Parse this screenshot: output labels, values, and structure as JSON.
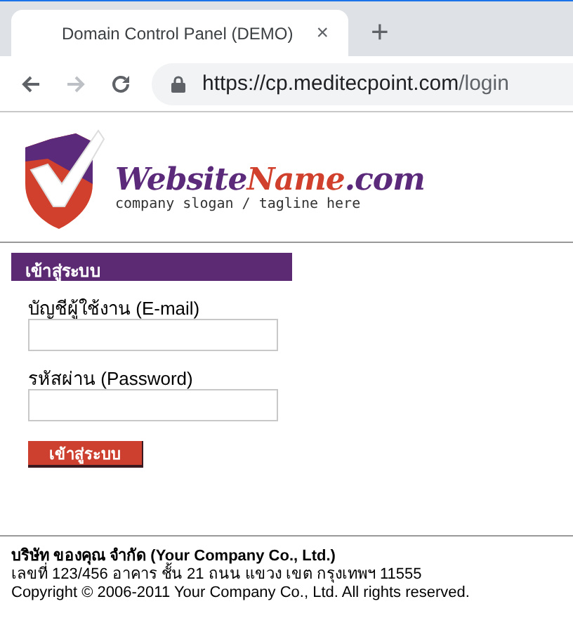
{
  "browser": {
    "tab_title": "Domain Control Panel (DEMO)",
    "tab_close": "×",
    "new_tab": "+",
    "url_host": "https://cp.meditecpoint.com",
    "url_path": "/login"
  },
  "logo": {
    "name_parts": [
      {
        "text": "Website",
        "color": "#5b2a7a"
      },
      {
        "text": "Name",
        "color": "#d0402c"
      },
      {
        "text": ".com",
        "color": "#5b2a7a"
      }
    ],
    "tagline": "company slogan / tagline here"
  },
  "login": {
    "heading": "เข้าสู่ระบบ",
    "fields": [
      {
        "label": "บัญชีผู้ใช้งาน (E-mail)"
      },
      {
        "label": "รหัสผ่าน (Password)"
      }
    ],
    "submit": "เข้าสู่ระบบ"
  },
  "footer": {
    "company": "บริษัท ของคุณ จำกัด (Your Company Co., Ltd.)",
    "address": "เลขที่ 123/456 อาคาร ชั้น 21 ถนน แขวง เขต กรุงเทพฯ 11555",
    "copyright": "Copyright © 2006-2011 Your Company Co., Ltd. All rights reserved."
  }
}
